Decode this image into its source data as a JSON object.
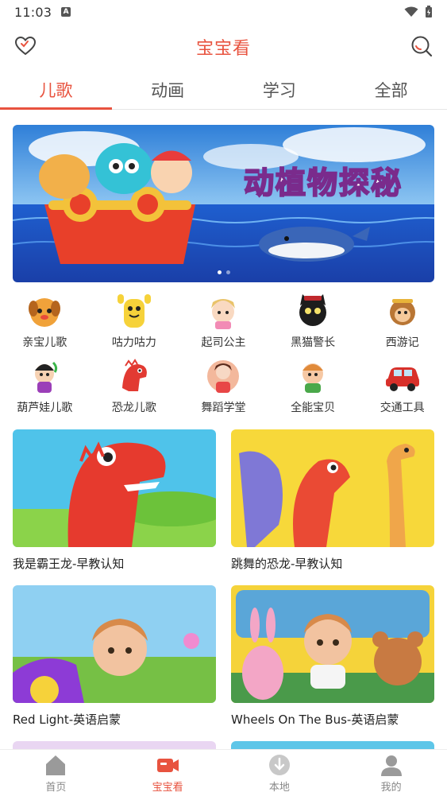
{
  "status_bar": {
    "time": "11:03",
    "notification_letter": "A"
  },
  "header": {
    "title": "宝宝看",
    "left_icon": "heart-outline-icon",
    "right_icon": "search-icon"
  },
  "tabs": [
    {
      "label": "儿歌",
      "active": true
    },
    {
      "label": "动画",
      "active": false
    },
    {
      "label": "学习",
      "active": false
    },
    {
      "label": "全部",
      "active": false
    }
  ],
  "banner": {
    "caption": "动植物探秘",
    "dots": 2,
    "active_dot": 0
  },
  "categories": [
    {
      "label": "亲宝儿歌",
      "icon": "puppy-icon"
    },
    {
      "label": "咕力咕力",
      "icon": "yellow-creature-icon"
    },
    {
      "label": "起司公主",
      "icon": "princess-icon"
    },
    {
      "label": "黑猫警长",
      "icon": "black-cat-icon"
    },
    {
      "label": "西游记",
      "icon": "monkey-king-icon"
    },
    {
      "label": "葫芦娃儿歌",
      "icon": "gourd-doll-icon"
    },
    {
      "label": "恐龙儿歌",
      "icon": "dinosaur-icon"
    },
    {
      "label": "舞蹈学堂",
      "icon": "dancer-icon"
    },
    {
      "label": "全能宝贝",
      "icon": "baby-icon"
    },
    {
      "label": "交通工具",
      "icon": "car-icon"
    }
  ],
  "videos": [
    {
      "title": "我是霸王龙-早教认知"
    },
    {
      "title": "跳舞的恐龙-早教认知"
    },
    {
      "title": "Red Light-英语启蒙"
    },
    {
      "title": "Wheels On The Bus-英语启蒙"
    }
  ],
  "bottom_nav": [
    {
      "label": "首页",
      "icon": "home-icon",
      "active": false
    },
    {
      "label": "宝宝看",
      "icon": "video-camera-icon",
      "active": true
    },
    {
      "label": "本地",
      "icon": "download-icon",
      "active": false
    },
    {
      "label": "我的",
      "icon": "user-icon",
      "active": false
    }
  ],
  "colors": {
    "accent": "#e8533f",
    "tab_text": "#555555",
    "nav_inactive": "#888888"
  }
}
